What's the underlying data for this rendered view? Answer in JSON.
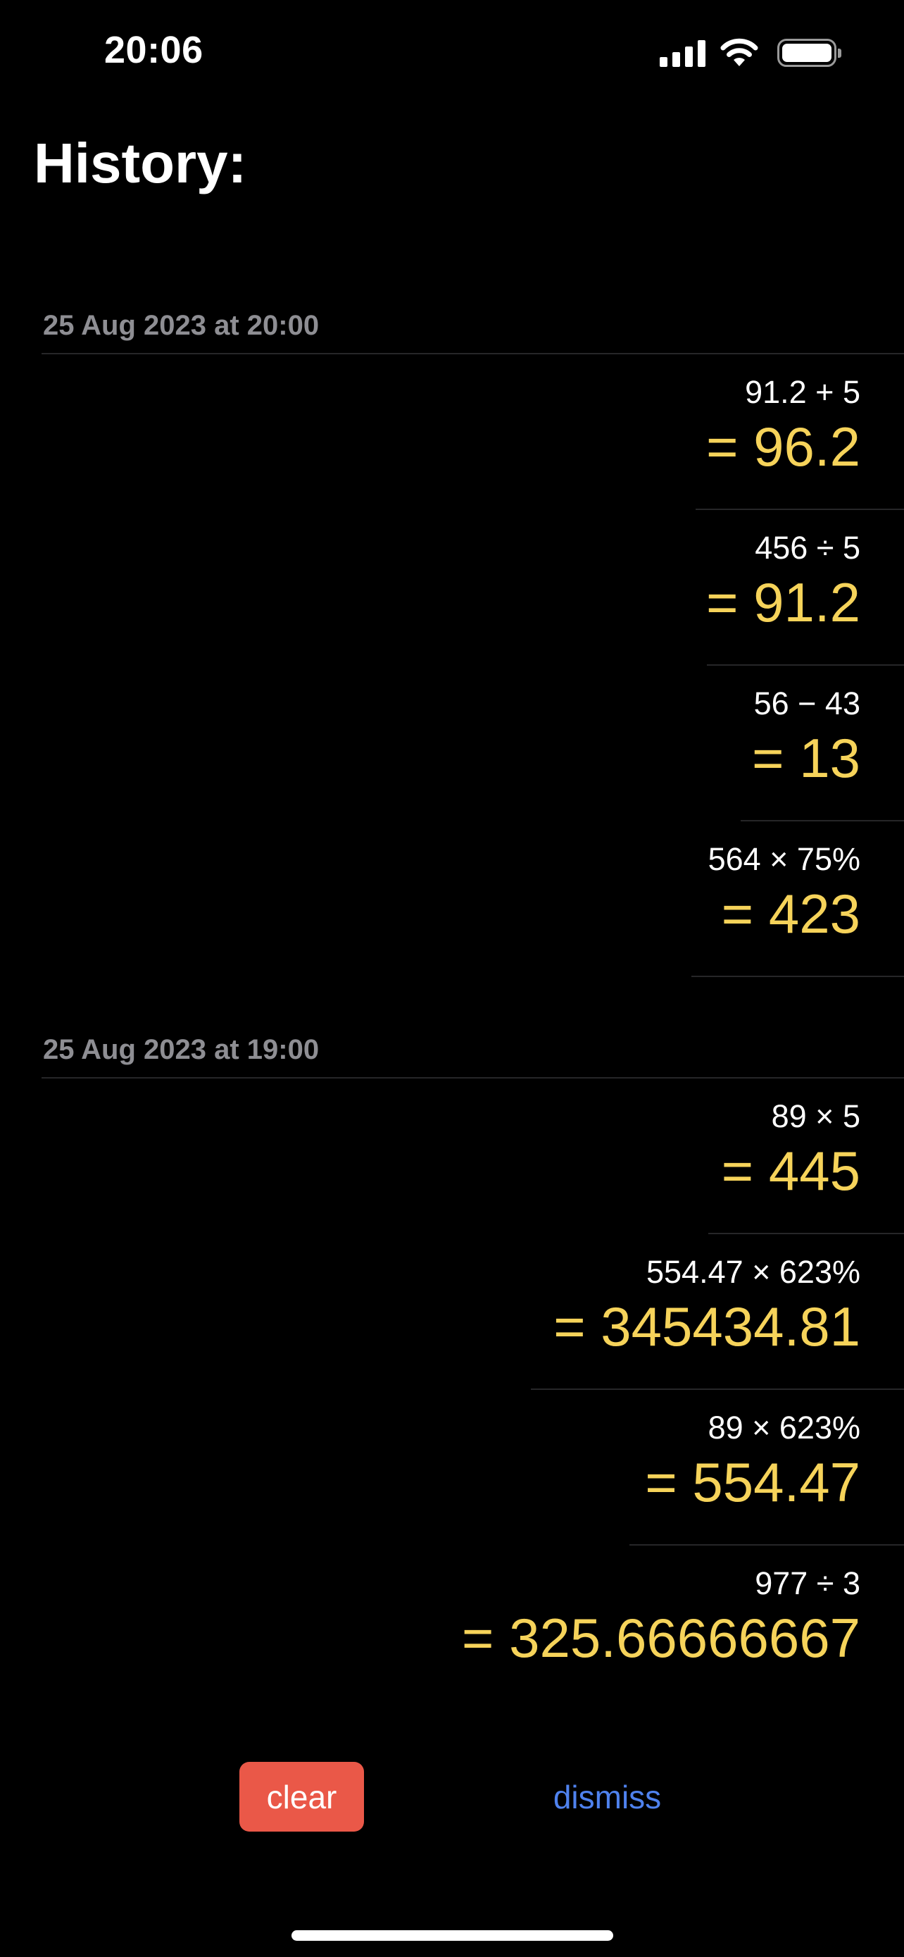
{
  "status_bar": {
    "time": "20:06",
    "icons": [
      "cellular-signal-icon",
      "wifi-icon",
      "battery-icon"
    ]
  },
  "title": "History:",
  "sections": [
    {
      "header": "25 Aug 2023 at 20:00",
      "entries": [
        {
          "expression": "91.2 + 5",
          "result": "= 96.2"
        },
        {
          "expression": "456 ÷ 5",
          "result": "= 91.2"
        },
        {
          "expression": "56 − 43",
          "result": "= 13"
        },
        {
          "expression": "564 × 75%",
          "result": "= 423"
        }
      ]
    },
    {
      "header": "25 Aug 2023 at 19:00",
      "entries": [
        {
          "expression": "89 × 5",
          "result": "= 445"
        },
        {
          "expression": "554.47 × 623%",
          "result": "= 345434.81"
        },
        {
          "expression": "89 × 623%",
          "result": "= 554.47"
        },
        {
          "expression": "977 ÷ 3",
          "result": "= 325.66666667"
        }
      ]
    }
  ],
  "actions": {
    "clear_label": "clear",
    "dismiss_label": "dismiss"
  },
  "colors": {
    "background": "#000000",
    "result": "#f6d35a",
    "clear_button": "#ea5848",
    "dismiss_link": "#4f82ee",
    "section_header": "#8e8e93"
  }
}
